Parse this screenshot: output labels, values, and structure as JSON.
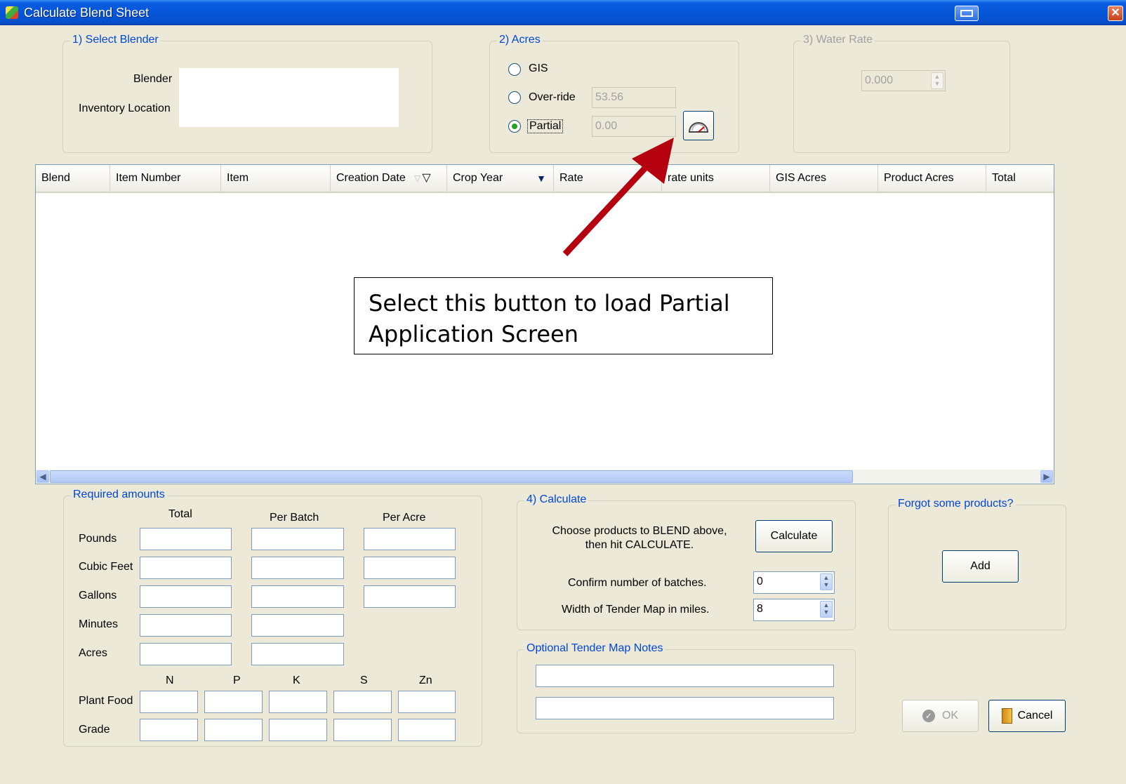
{
  "window": {
    "title": "Calculate Blend Sheet"
  },
  "select_blender": {
    "legend": "1) Select Blender",
    "blender_label": "Blender",
    "inventory_label": "Inventory Location"
  },
  "acres": {
    "legend": "2) Acres",
    "gis_label": "GIS",
    "override_label": "Over-ride",
    "override_value": "53.56",
    "partial_label": "Partial",
    "partial_value": "0.00",
    "selected": "Partial"
  },
  "water_rate": {
    "legend": "3) Water Rate",
    "value": "0.000"
  },
  "grid": {
    "columns": [
      "Blend",
      "Item Number",
      "Item",
      "Creation Date",
      "Crop Year",
      "Rate",
      "rate units",
      "GIS Acres",
      "Product Acres",
      "Total"
    ]
  },
  "callout": {
    "text": "Select this button to load Partial Application Screen"
  },
  "required": {
    "legend": "Required amounts",
    "col_total": "Total",
    "col_batch": "Per Batch",
    "col_acre": "Per Acre",
    "rows": [
      "Pounds",
      "Cubic Feet",
      "Gallons",
      "Minutes",
      "Acres"
    ],
    "nutrients": [
      "N",
      "P",
      "K",
      "S",
      "Zn"
    ],
    "plant_food_label": "Plant Food",
    "grade_label": "Grade"
  },
  "calculate": {
    "legend": "4) Calculate",
    "instruction_line1": "Choose products to BLEND above,",
    "instruction_line2": "then hit CALCULATE.",
    "button": "Calculate",
    "batches_label": "Confirm number of batches.",
    "batches_value": "0",
    "width_label": "Width of Tender Map in miles.",
    "width_value": "8"
  },
  "notes": {
    "legend": "Optional Tender Map Notes"
  },
  "forgot": {
    "legend": "Forgot some products?",
    "add_button": "Add"
  },
  "footer": {
    "ok": "OK",
    "cancel": "Cancel"
  },
  "colors": {
    "legend_blue": "#0046d5",
    "title_bar": "#0656d8",
    "arrow": "#b5000f",
    "radio_dot": "#25a025"
  }
}
